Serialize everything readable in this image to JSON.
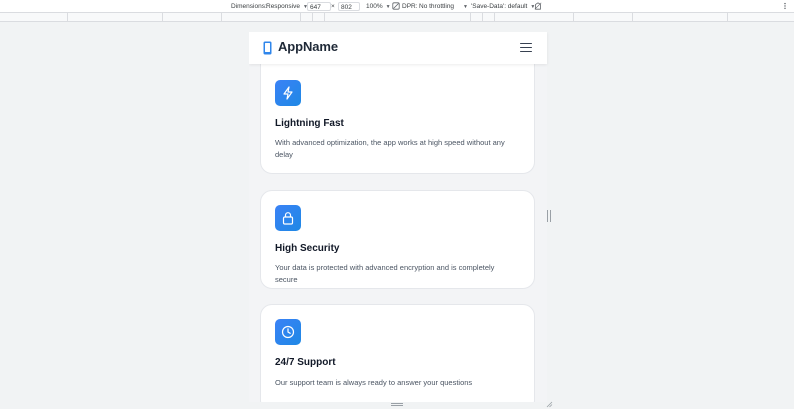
{
  "devtools": {
    "dimensions_label": "Dimensions:",
    "device": "Responsive",
    "width": "647",
    "times": "×",
    "height": "802",
    "zoom": "100%",
    "dpr_label": "DPR:",
    "throttling": "No throttling",
    "save_data": "'Save-Data': default"
  },
  "app": {
    "title": "AppName"
  },
  "features": [
    {
      "icon": "lightning-icon",
      "title": "Lightning Fast",
      "description": "With advanced optimization, the app works at high speed without any delay"
    },
    {
      "icon": "lock-icon",
      "title": "High Security",
      "description": "Your data is protected with advanced encryption and is completely secure"
    },
    {
      "icon": "clock-icon",
      "title": "24/7 Support",
      "description": "Our support team is always ready to answer your questions"
    }
  ],
  "colors": {
    "accent": "#2f86eb",
    "card_border": "#e5e7eb",
    "page_bg": "#f3f4f6"
  }
}
